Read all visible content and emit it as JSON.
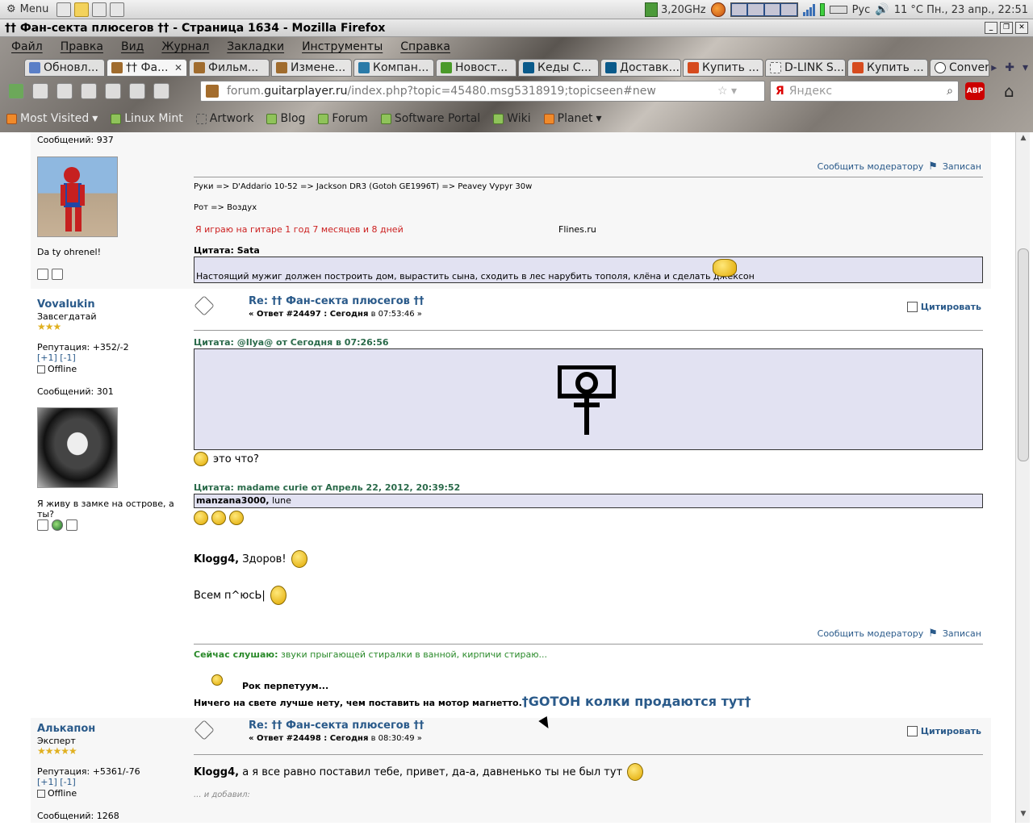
{
  "taskbar": {
    "menu_label": "Menu",
    "cpu_freq": "3,20GHz",
    "keyboard_layout": "Рус",
    "weather_clock": "11 °C Пн., 23 апр., 22:51"
  },
  "window": {
    "title": "†† Фан-секта плюсегов †† - Страница 1634 - Mozilla Firefox"
  },
  "menubar": [
    "Файл",
    "Правка",
    "Вид",
    "Журнал",
    "Закладки",
    "Инструменты",
    "Справка"
  ],
  "tabs": [
    {
      "label": "Обновл...",
      "icon": "b"
    },
    {
      "label": "†† Фа...",
      "icon": "g",
      "active": true
    },
    {
      "label": "Фильм...",
      "icon": "g"
    },
    {
      "label": "Измене...",
      "icon": "g"
    },
    {
      "label": "Компан...",
      "icon": "s"
    },
    {
      "label": "Новост...",
      "icon": "w"
    },
    {
      "label": "Кеды С...",
      "icon": "k"
    },
    {
      "label": "Доставк...",
      "icon": "k"
    },
    {
      "label": "Купить ...",
      "icon": "r"
    },
    {
      "label": "D-LINK S...",
      "icon": "d"
    },
    {
      "label": "Купить ...",
      "icon": "r"
    },
    {
      "label": "Conver",
      "icon": "c"
    }
  ],
  "url": {
    "prefix": "forum.",
    "domain": "guitarplayer.ru",
    "path": "/index.php?topic=45480.msg5318919;topicseen#new"
  },
  "search": {
    "engine": "Я",
    "placeholder": "Яндекс"
  },
  "abp_label": "ABP",
  "bookmarks": [
    "Most Visited",
    "Linux Mint",
    "Artwork",
    "Blog",
    "Forum",
    "Software Portal",
    "Wiki",
    "Planet"
  ],
  "post0": {
    "messages": "Сообщений: 937",
    "user_text": "Da ty ohrenel!",
    "report": "Сообщить модератору",
    "logged": "Записан",
    "sig_line1": "Руки => D'Addario 10-52 => Jackson DR3 (Gotoh GE1996T) => Peavey Vypyr 30w",
    "sig_line2": "Рот => Воздух",
    "sig_red": "Я играю на гитаре 1 год 7 месяцев и 8 дней",
    "sig_flines": "Flines.ru",
    "quote_head": "Цитата: Sata",
    "quote_text": "Настоящий мужиг должен построить дом, вырастить сына, сходить в лес нарубить тополя, клёна и сделать джексон"
  },
  "post1": {
    "username": "Vovalukin",
    "rank": "Завсегдатай",
    "stars": "★★★",
    "reputation": "Репутация: +352/-2",
    "rep_links": "[+1] [-1]",
    "status": "Offline",
    "messages": "Сообщений: 301",
    "user_text": "Я живу в замке на острове, а ты?",
    "title": "Re: †† Фан-секта плюсегов ††",
    "meta_prefix": "« Ответ #24497 : Сегодня",
    "meta_suffix": " в 07:53:46 »",
    "quote_btn": "Цитировать",
    "quote1_head": "Цитата: @Ilya@ от Сегодня в 07:26:56",
    "text1": "это что?",
    "quote2_head": "Цитата: madame curie от Апрель 22, 2012, 20:39:52",
    "quote2_name": "manzana3000,",
    "quote2_text": " lune",
    "line1_name": "Klogg4,",
    "line1_text": " Здоров!",
    "line2": "Всем п^юсЬ|",
    "report": "Сообщить модератору",
    "logged": "Записан",
    "listening_label": "Сейчас слушаю:",
    "listening_text": "звуки прыгающей стиралки в ванной, кирпичи стираю...",
    "rock": "Рок перпетуум...",
    "motto": "Ничего на свете лучше нету, чем поставить на мотор магнетто.",
    "gotoh": "†GOTOH колки продаются тут†"
  },
  "post2": {
    "username": "Алькапон",
    "rank": "Эксперт",
    "stars": "★★★★★",
    "reputation": "Репутация: +5361/-76",
    "rep_links": "[+1] [-1]",
    "status": "Offline",
    "messages": "Сообщений: 1268",
    "title": "Re: †† Фан-секта плюсегов ††",
    "meta_prefix": "« Ответ #24498 : Сегодня",
    "meta_suffix": " в 08:30:49 »",
    "quote_btn": "Цитировать",
    "line_name": "Klogg4,",
    "line_text": " а я все равно поставил тебе, привет, да-а, давненько ты не был тут",
    "added": "... и добавил:"
  }
}
